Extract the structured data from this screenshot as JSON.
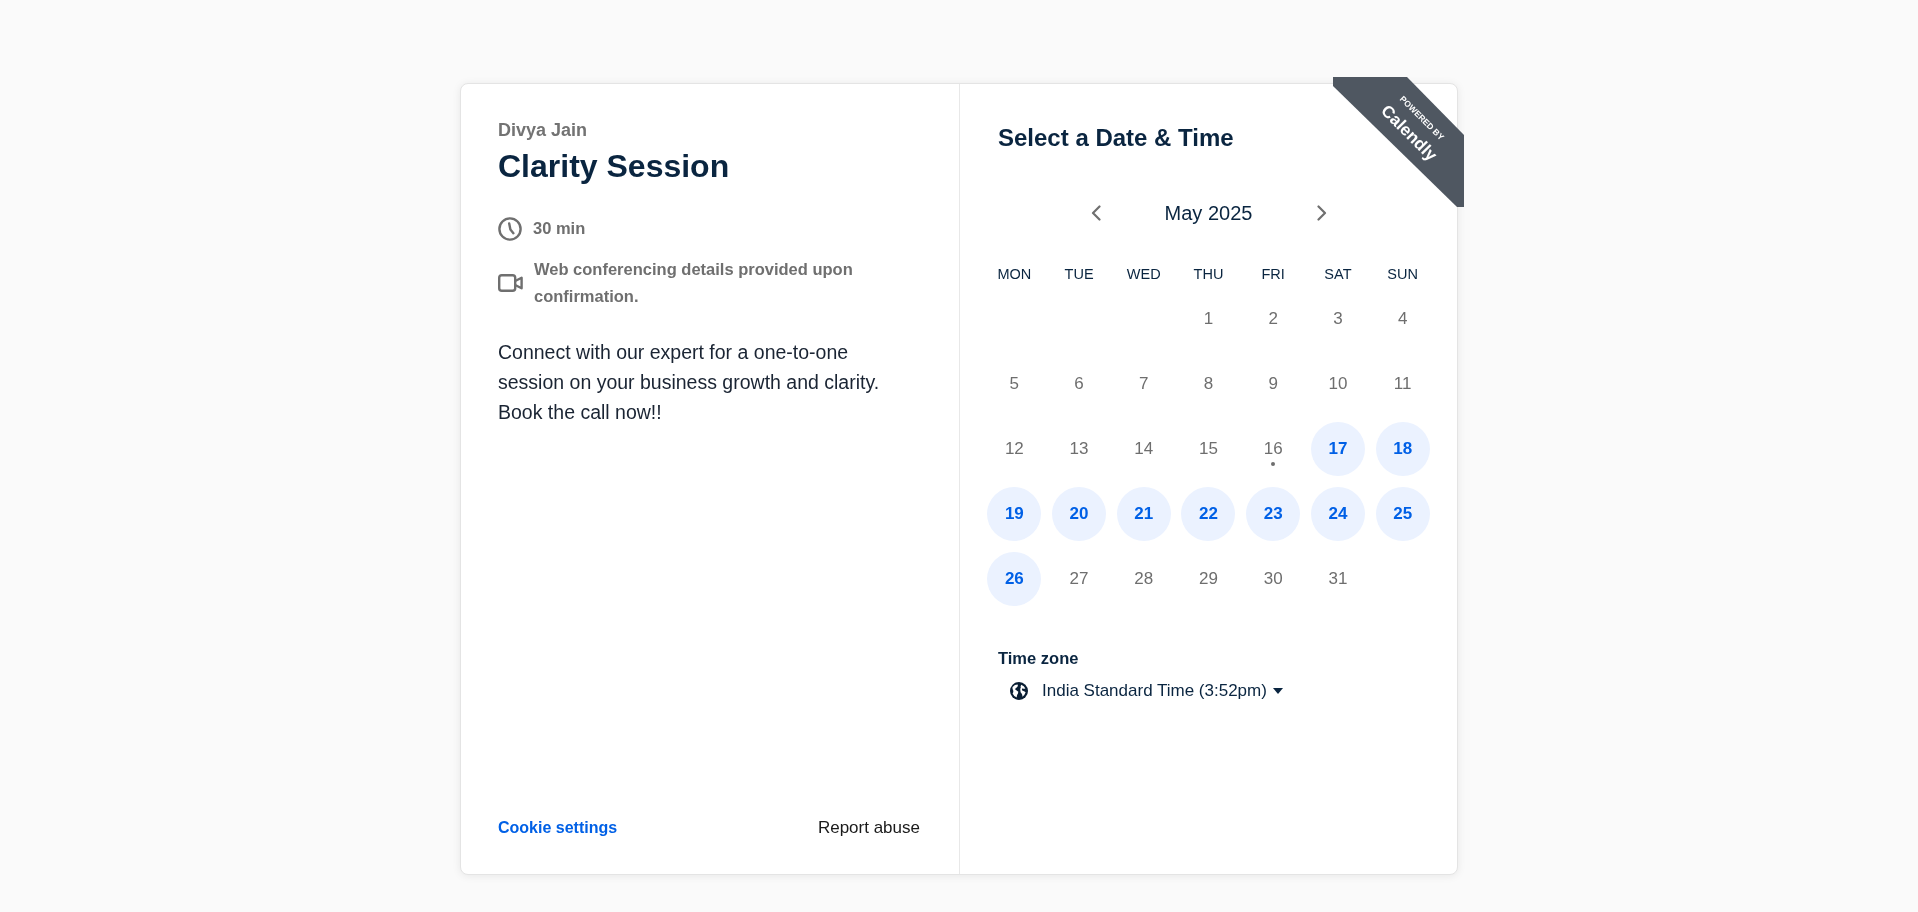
{
  "organizer": {
    "name": "Divya Jain"
  },
  "event": {
    "title": "Clarity Session",
    "details": [
      {
        "kind": "duration",
        "text": "30 min"
      },
      {
        "kind": "video",
        "text": "Web conferencing details provided upon confirmation."
      }
    ],
    "description": "Connect with our expert for a one-to-one session on your business growth and clarity. Book the call now!!"
  },
  "footer": {
    "cookie_settings_link": "Cookie settings",
    "report_link": "Report abuse"
  },
  "ribbon": {
    "line_1": "POWERED BY",
    "line_2": "Calendly"
  },
  "calendar": {
    "heading": "Select a Date & Time",
    "month": "May 2025",
    "weekdays": [
      "MON",
      "TUE",
      "WED",
      "THU",
      "FRI",
      "SAT",
      "SUN"
    ],
    "weeks": [
      {
        "thu": {
          "day": "1",
          "available": false,
          "selected": false,
          "today": false
        },
        "fri": {
          "day": "2",
          "available": false,
          "selected": false,
          "today": false
        },
        "sat": {
          "day": "3",
          "available": false,
          "selected": false,
          "today": false
        },
        "sun": {
          "day": "4",
          "available": false,
          "selected": false,
          "today": false
        }
      },
      {
        "mon": {
          "day": "5",
          "available": false,
          "selected": false,
          "today": false
        },
        "tue": {
          "day": "6",
          "available": false,
          "selected": false,
          "today": false
        },
        "wed": {
          "day": "7",
          "available": false,
          "selected": false,
          "today": false
        },
        "thu": {
          "day": "8",
          "available": false,
          "selected": false,
          "today": false
        },
        "fri": {
          "day": "9",
          "available": false,
          "selected": false,
          "today": false
        },
        "sat": {
          "day": "10",
          "available": false,
          "selected": false,
          "today": false
        },
        "sun": {
          "day": "11",
          "available": false,
          "selected": false,
          "today": false
        }
      },
      {
        "mon": {
          "day": "12",
          "available": false,
          "selected": false,
          "today": false
        },
        "tue": {
          "day": "13",
          "available": false,
          "selected": false,
          "today": false
        },
        "wed": {
          "day": "14",
          "available": false,
          "selected": false,
          "today": false
        },
        "thu": {
          "day": "15",
          "available": false,
          "selected": false,
          "today": false
        },
        "fri": {
          "day": "16",
          "available": false,
          "selected": false,
          "today": true
        },
        "sat": {
          "day": "17",
          "available": true,
          "selected": false,
          "today": false
        },
        "sun": {
          "day": "18",
          "available": true,
          "selected": false,
          "today": false
        }
      },
      {
        "mon": {
          "day": "19",
          "available": true,
          "selected": false,
          "today": false
        },
        "tue": {
          "day": "20",
          "available": true,
          "selected": false,
          "today": false
        },
        "wed": {
          "day": "21",
          "available": true,
          "selected": false,
          "today": false
        },
        "thu": {
          "day": "22",
          "available": true,
          "selected": false,
          "today": false
        },
        "fri": {
          "day": "23",
          "available": true,
          "selected": false,
          "today": false
        },
        "sat": {
          "day": "24",
          "available": true,
          "selected": false,
          "today": false
        },
        "sun": {
          "day": "25",
          "available": true,
          "selected": false,
          "today": false
        }
      },
      {
        "mon": {
          "day": "26",
          "available": true,
          "selected": false,
          "today": false
        },
        "tue": {
          "day": "27",
          "available": false,
          "selected": false,
          "today": false
        },
        "wed": {
          "day": "28",
          "available": false,
          "selected": false,
          "today": false
        },
        "thu": {
          "day": "29",
          "available": false,
          "selected": false,
          "today": false
        },
        "fri": {
          "day": "30",
          "available": false,
          "selected": false,
          "today": false
        },
        "sat": {
          "day": "31",
          "available": false,
          "selected": false,
          "today": false
        }
      }
    ]
  },
  "timezone": {
    "label": "Time zone",
    "value": "India Standard Time (3:52pm)"
  }
}
